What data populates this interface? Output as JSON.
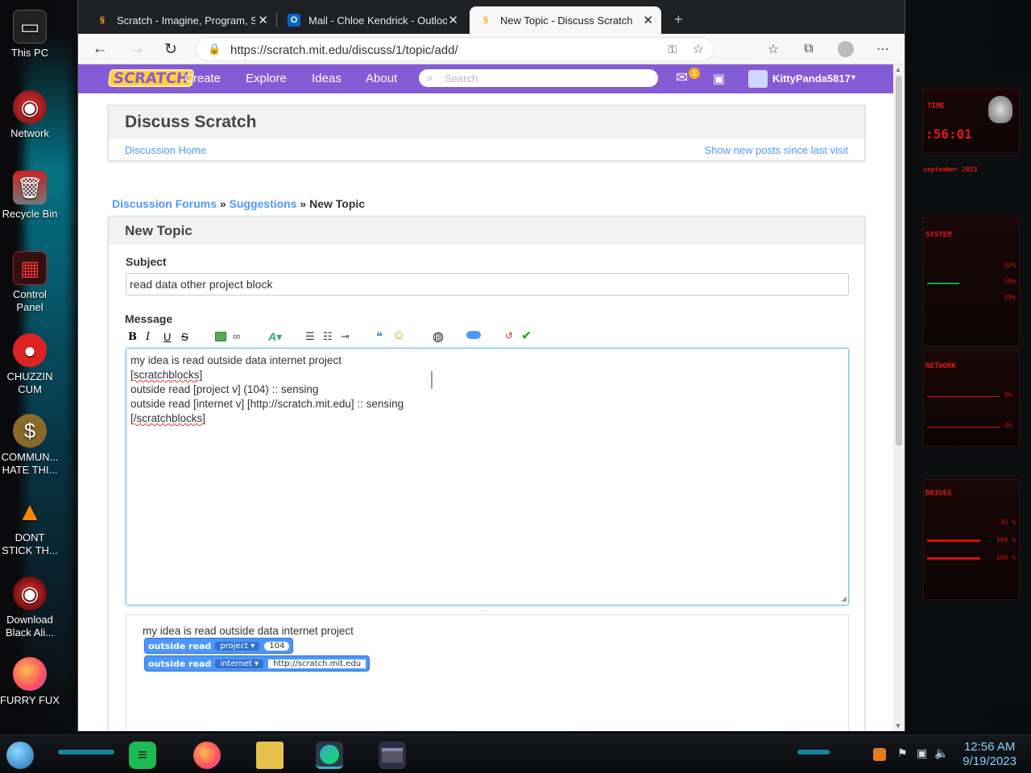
{
  "desktop": {
    "icons": [
      {
        "label": "This PC",
        "icon": "computer-icon"
      },
      {
        "label": "Network",
        "icon": "network-icon"
      },
      {
        "label": "Recycle Bin",
        "icon": "recycle-bin-icon"
      },
      {
        "label": "Control Panel",
        "icon": "control-panel-icon"
      },
      {
        "label": "CHUZZIN CUM",
        "icon": "chuzzle-icon"
      },
      {
        "label": "COMMUN... HATE THI...",
        "icon": "money-bag-icon"
      },
      {
        "label": "DONT STICK TH...",
        "icon": "traffic-cone-icon"
      },
      {
        "label": "Download Black Ali...",
        "icon": "alien-icon"
      },
      {
        "label": "FURRY FUX",
        "icon": "firefox-icon"
      }
    ],
    "widget": {
      "time_label": "TIME",
      "time_value": ":56:01",
      "date_value": "september 2023",
      "system_label": "SYSTEM",
      "sys_values": [
        "32%",
        "59%",
        "49%"
      ],
      "network_label": "NETWORK",
      "net_values": [
        "0%",
        "0%"
      ],
      "drives_label": "DRIVES",
      "drive_values": [
        "33 %",
        "100 %",
        "100 %"
      ]
    }
  },
  "browser": {
    "tabs": [
      {
        "title": "Scratch - Imagine, Program, Sha",
        "icon": "scratch-favicon",
        "active": false
      },
      {
        "title": "Mail - Chloe Kendrick - Outlook",
        "icon": "outlook-icon",
        "active": false
      },
      {
        "title": "New Topic - Discuss Scratch",
        "icon": "scratch-favicon",
        "active": true
      }
    ],
    "url": "https://scratch.mit.edu/discuss/1/topic/add/"
  },
  "scratch": {
    "logo": "SCRATCH",
    "nav": [
      "Create",
      "Explore",
      "Ideas",
      "About"
    ],
    "search_placeholder": "Search",
    "notification_count": "1",
    "username": "KittyPanda5817"
  },
  "discuss": {
    "title": "Discuss Scratch",
    "home_link": "Discussion Home",
    "new_posts_link": "Show new posts since last visit"
  },
  "breadcrumb": {
    "forums": "Discussion Forums",
    "sep1": "»",
    "suggestions": "Suggestions",
    "sep2": "»",
    "current": "New Topic"
  },
  "form": {
    "heading": "New Topic",
    "subject_label": "Subject",
    "subject_value": "read data other project block",
    "message_label": "Message",
    "message_lines": [
      "my idea is read outside data internet project",
      "[scratchblocks]",
      "outside read [project v] (104) :: sensing",
      "outside read [internet v] [http://scratch.mit.edu] :: sensing",
      "[/scratchblocks]"
    ],
    "toolbar": [
      "B",
      "I",
      "U",
      "S"
    ]
  },
  "preview": {
    "text": "my idea is read outside data internet project",
    "blocks": [
      {
        "label": "outside read",
        "dropdown": "project",
        "input": "104"
      },
      {
        "label": "outside read",
        "dropdown": "internet",
        "input": "http://scratch.mit.edu"
      }
    ]
  },
  "taskbar": {
    "time": "12:56 AM",
    "date": "9/19/2023"
  }
}
